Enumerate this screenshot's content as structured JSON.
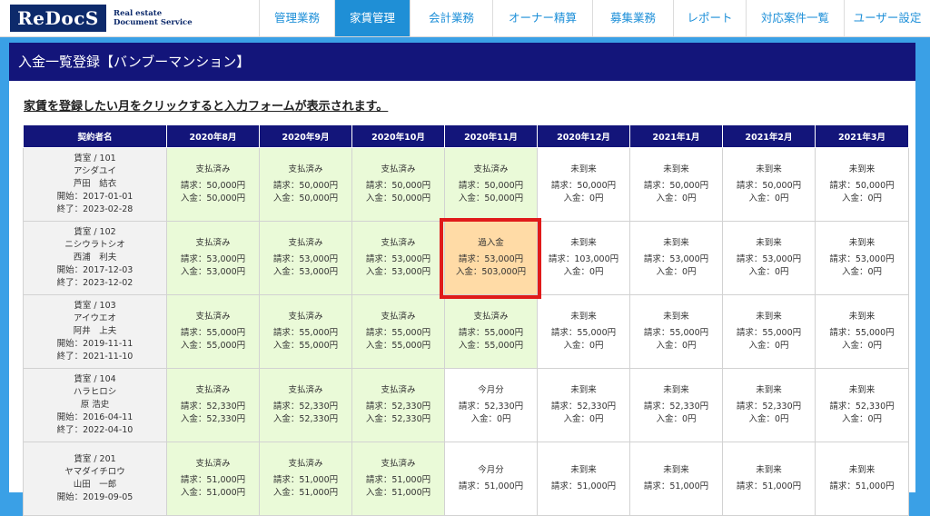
{
  "brand": {
    "logo_text": "ReDocS",
    "sub_line1": "Real estate",
    "sub_line2": "Document Service"
  },
  "nav": {
    "items": [
      {
        "label": "管理業務",
        "active": false
      },
      {
        "label": "家賃管理",
        "active": true
      },
      {
        "label": "会計業務",
        "active": false
      },
      {
        "label": "オーナー精算",
        "active": false
      },
      {
        "label": "募集業務",
        "active": false
      },
      {
        "label": "レポート",
        "active": false
      },
      {
        "label": "対応案件一覧",
        "active": false
      },
      {
        "label": "ユーザー設定",
        "active": false
      }
    ]
  },
  "page": {
    "title": "入金一覧登録【バンブーマンション】",
    "instruction": "家賃を登録したい月をクリックすると入力フォームが表示されます。"
  },
  "table": {
    "headers": [
      "契約者名",
      "2020年8月",
      "2020年9月",
      "2020年10月",
      "2020年11月",
      "2020年12月",
      "2021年1月",
      "2021年2月",
      "2021年3月"
    ],
    "rows": [
      {
        "room": "賃室 / 101",
        "kana": "アシダユイ",
        "name": "芦田　結衣",
        "start": "開始：2017-01-01",
        "end": "終了：2023-02-28",
        "cells": [
          {
            "status": "支払済み",
            "billed": "請求：50,000円",
            "received": "入金：50,000円",
            "state": "paid"
          },
          {
            "status": "支払済み",
            "billed": "請求：50,000円",
            "received": "入金：50,000円",
            "state": "paid"
          },
          {
            "status": "支払済み",
            "billed": "請求：50,000円",
            "received": "入金：50,000円",
            "state": "paid"
          },
          {
            "status": "支払済み",
            "billed": "請求：50,000円",
            "received": "入金：50,000円",
            "state": "paid"
          },
          {
            "status": "未到来",
            "billed": "請求：50,000円",
            "received": "入金：0円",
            "state": "unpaid"
          },
          {
            "status": "未到来",
            "billed": "請求：50,000円",
            "received": "入金：0円",
            "state": "unpaid"
          },
          {
            "status": "未到来",
            "billed": "請求：50,000円",
            "received": "入金：0円",
            "state": "unpaid"
          },
          {
            "status": "未到来",
            "billed": "請求：50,000円",
            "received": "入金：0円",
            "state": "unpaid"
          }
        ]
      },
      {
        "room": "賃室 / 102",
        "kana": "ニシウラトシオ",
        "name": "西浦　利夫",
        "start": "開始：2017-12-03",
        "end": "終了：2023-12-02",
        "cells": [
          {
            "status": "支払済み",
            "billed": "請求：53,000円",
            "received": "入金：53,000円",
            "state": "paid"
          },
          {
            "status": "支払済み",
            "billed": "請求：53,000円",
            "received": "入金：53,000円",
            "state": "paid"
          },
          {
            "status": "支払済み",
            "billed": "請求：53,000円",
            "received": "入金：53,000円",
            "state": "paid"
          },
          {
            "status": "過入金",
            "billed": "請求：53,000円",
            "received": "入金：503,000円",
            "state": "over"
          },
          {
            "status": "未到来",
            "billed": "請求：103,000円",
            "received": "入金：0円",
            "state": "unpaid"
          },
          {
            "status": "未到来",
            "billed": "請求：53,000円",
            "received": "入金：0円",
            "state": "unpaid"
          },
          {
            "status": "未到来",
            "billed": "請求：53,000円",
            "received": "入金：0円",
            "state": "unpaid"
          },
          {
            "status": "未到来",
            "billed": "請求：53,000円",
            "received": "入金：0円",
            "state": "unpaid"
          }
        ]
      },
      {
        "room": "賃室 / 103",
        "kana": "アイウエオ",
        "name": "阿井　上夫",
        "start": "開始：2019-11-11",
        "end": "終了：2021-11-10",
        "cells": [
          {
            "status": "支払済み",
            "billed": "請求：55,000円",
            "received": "入金：55,000円",
            "state": "paid"
          },
          {
            "status": "支払済み",
            "billed": "請求：55,000円",
            "received": "入金：55,000円",
            "state": "paid"
          },
          {
            "status": "支払済み",
            "billed": "請求：55,000円",
            "received": "入金：55,000円",
            "state": "paid"
          },
          {
            "status": "支払済み",
            "billed": "請求：55,000円",
            "received": "入金：55,000円",
            "state": "paid"
          },
          {
            "status": "未到来",
            "billed": "請求：55,000円",
            "received": "入金：0円",
            "state": "unpaid"
          },
          {
            "status": "未到来",
            "billed": "請求：55,000円",
            "received": "入金：0円",
            "state": "unpaid"
          },
          {
            "status": "未到来",
            "billed": "請求：55,000円",
            "received": "入金：0円",
            "state": "unpaid"
          },
          {
            "status": "未到来",
            "billed": "請求：55,000円",
            "received": "入金：0円",
            "state": "unpaid"
          }
        ]
      },
      {
        "room": "賃室 / 104",
        "kana": "ハラヒロシ",
        "name": "原 浩史",
        "start": "開始：2016-04-11",
        "end": "終了：2022-04-10",
        "cells": [
          {
            "status": "支払済み",
            "billed": "請求：52,330円",
            "received": "入金：52,330円",
            "state": "paid"
          },
          {
            "status": "支払済み",
            "billed": "請求：52,330円",
            "received": "入金：52,330円",
            "state": "paid"
          },
          {
            "status": "支払済み",
            "billed": "請求：52,330円",
            "received": "入金：52,330円",
            "state": "paid"
          },
          {
            "status": "今月分",
            "billed": "請求：52,330円",
            "received": "入金：0円",
            "state": "unpaid"
          },
          {
            "status": "未到来",
            "billed": "請求：52,330円",
            "received": "入金：0円",
            "state": "unpaid"
          },
          {
            "status": "未到来",
            "billed": "請求：52,330円",
            "received": "入金：0円",
            "state": "unpaid"
          },
          {
            "status": "未到来",
            "billed": "請求：52,330円",
            "received": "入金：0円",
            "state": "unpaid"
          },
          {
            "status": "未到来",
            "billed": "請求：52,330円",
            "received": "入金：0円",
            "state": "unpaid"
          }
        ]
      },
      {
        "room": "賃室 / 201",
        "kana": "ヤマダイチロウ",
        "name": "山田　一郎",
        "start": "開始：2019-09-05",
        "end": "",
        "cells": [
          {
            "status": "支払済み",
            "billed": "請求：51,000円",
            "received": "入金：51,000円",
            "state": "paid"
          },
          {
            "status": "支払済み",
            "billed": "請求：51,000円",
            "received": "入金：51,000円",
            "state": "paid"
          },
          {
            "status": "支払済み",
            "billed": "請求：51,000円",
            "received": "入金：51,000円",
            "state": "paid"
          },
          {
            "status": "今月分",
            "billed": "請求：51,000円",
            "received": "",
            "state": "unpaid"
          },
          {
            "status": "未到来",
            "billed": "請求：51,000円",
            "received": "",
            "state": "unpaid"
          },
          {
            "status": "未到来",
            "billed": "請求：51,000円",
            "received": "",
            "state": "unpaid"
          },
          {
            "status": "未到来",
            "billed": "請求：51,000円",
            "received": "",
            "state": "unpaid"
          },
          {
            "status": "未到来",
            "billed": "請求：51,000円",
            "received": "",
            "state": "unpaid"
          }
        ]
      }
    ]
  }
}
